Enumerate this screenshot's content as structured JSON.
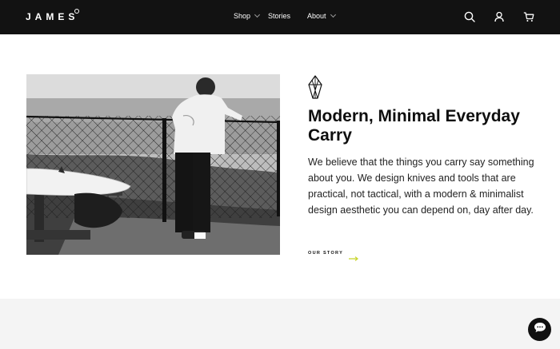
{
  "header": {
    "logo": "JAMES",
    "nav": [
      {
        "label": "Shop",
        "has_dropdown": true
      },
      {
        "label": "Stories",
        "has_dropdown": false
      },
      {
        "label": "About",
        "has_dropdown": true
      }
    ],
    "icons": [
      "search-icon",
      "account-icon",
      "cart-icon"
    ]
  },
  "hero": {
    "image_alt": "Person leaning on a chain-link fence overlooking the ocean beside a surfboard",
    "headline": "Modern, Minimal Everyday Carry",
    "body": "We believe that the things you carry say something about you. We design knives and tools that are practical, not tactical, with a modern & minimalist design aesthetic you can depend on, day after day.",
    "cta_label": "OUR STORY"
  },
  "colors": {
    "header_bg": "#121212",
    "accent": "#c9d62f",
    "section_bg": "#f4f4f4",
    "chat_bg": "#111111"
  },
  "chat": {
    "icon": "chat-bubble-icon"
  }
}
